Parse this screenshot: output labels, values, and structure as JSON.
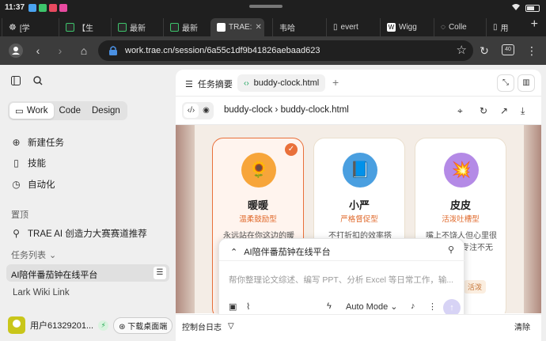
{
  "status_bar": {
    "time": "11:37"
  },
  "browser": {
    "tabs": [
      {
        "label": "[学"
      },
      {
        "label": "【生"
      },
      {
        "label": "最新"
      },
      {
        "label": "最新"
      },
      {
        "label": "TRAE:"
      },
      {
        "label": "韦哈"
      },
      {
        "label": "evert"
      },
      {
        "label": "Wigg"
      },
      {
        "label": "Colle"
      },
      {
        "label": "用"
      }
    ],
    "url": "work.trae.cn/session/6a55c1df9b41826aebaad623",
    "tab_count": "40"
  },
  "sidebar": {
    "modes": [
      "Work",
      "Code",
      "Design"
    ],
    "nav": [
      {
        "label": "新建任务",
        "icon": "plus-circle-icon"
      },
      {
        "label": "技能",
        "icon": "book-icon"
      },
      {
        "label": "自动化",
        "icon": "clock-icon"
      }
    ],
    "pinned_label": "置顶",
    "pinned_item": "TRAE AI 创造力大赛赛道推荐",
    "tasks_label": "任务列表",
    "active_task": "AI陪伴番茄钟在线平台",
    "other_task": "Lark Wiki Link",
    "user_name": "用户61329201...",
    "download_label": "下载桌面端"
  },
  "main": {
    "summary_tab": "任务摘要",
    "file_tab": "buddy-clock.html",
    "breadcrumb": "buddy-clock › buddy-clock.html",
    "cards": [
      {
        "name": "暖暖",
        "type": "温柔鼓励型",
        "desc": "永远站在你这边的暖",
        "emoji": "🌻"
      },
      {
        "name": "小严",
        "type": "严格督促型",
        "desc": "不打折扣的效率搭",
        "emoji": "📘"
      },
      {
        "name": "皮皮",
        "type": "活泼吐槽型",
        "desc": "嘴上不饶人但心里很友，用幽专注不无",
        "emoji": "💥"
      }
    ],
    "chip": "活泼"
  },
  "chat": {
    "title": "AI陪伴番茄钟在线平台",
    "placeholder": "帮你整理论文综述、编写 PPT、分析 Excel 等日常工作，输...",
    "mode": "Auto Mode"
  },
  "console": {
    "label": "控制台日志",
    "clear": "清除"
  },
  "colors": {
    "accent": "#e9703a",
    "card_selected_bg": "#fff4ee",
    "send_button": "#d7d3f5"
  }
}
